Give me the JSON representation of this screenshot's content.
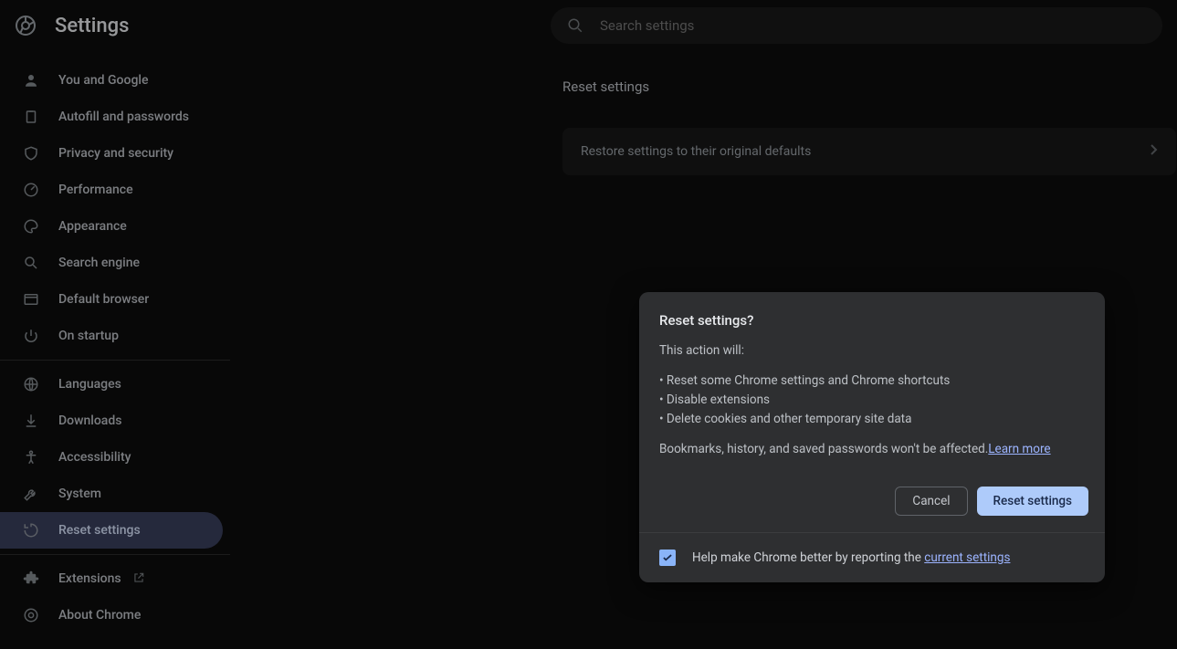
{
  "header": {
    "title": "Settings",
    "search_placeholder": "Search settings"
  },
  "sidebar": {
    "groups": [
      [
        {
          "icon": "person-icon",
          "label": "You and Google"
        },
        {
          "icon": "clipboard-icon",
          "label": "Autofill and passwords"
        },
        {
          "icon": "shield-icon",
          "label": "Privacy and security"
        },
        {
          "icon": "speedometer-icon",
          "label": "Performance"
        },
        {
          "icon": "palette-icon",
          "label": "Appearance"
        },
        {
          "icon": "search-icon",
          "label": "Search engine"
        },
        {
          "icon": "browser-icon",
          "label": "Default browser"
        },
        {
          "icon": "power-icon",
          "label": "On startup"
        }
      ],
      [
        {
          "icon": "globe-icon",
          "label": "Languages"
        },
        {
          "icon": "download-icon",
          "label": "Downloads"
        },
        {
          "icon": "accessibility-icon",
          "label": "Accessibility"
        },
        {
          "icon": "wrench-icon",
          "label": "System"
        },
        {
          "icon": "restore-icon",
          "label": "Reset settings",
          "active": true
        }
      ],
      [
        {
          "icon": "extension-icon",
          "label": "Extensions",
          "external": true
        },
        {
          "icon": "chrome-icon",
          "label": "About Chrome"
        }
      ]
    ]
  },
  "main": {
    "heading": "Reset settings",
    "row_label": "Restore settings to their original defaults"
  },
  "dialog": {
    "title": "Reset settings?",
    "intro": "This action will:",
    "bullets": [
      "Reset some Chrome settings and Chrome shortcuts",
      "Disable extensions",
      "Delete cookies and other temporary site data"
    ],
    "note_prefix": "Bookmarks, history, and saved passwords won't be affected.",
    "learn_more": "Learn more",
    "cancel_label": "Cancel",
    "confirm_label": "Reset settings",
    "footer_prefix": "Help make Chrome better by reporting the ",
    "footer_link": "current settings",
    "checked": true
  }
}
